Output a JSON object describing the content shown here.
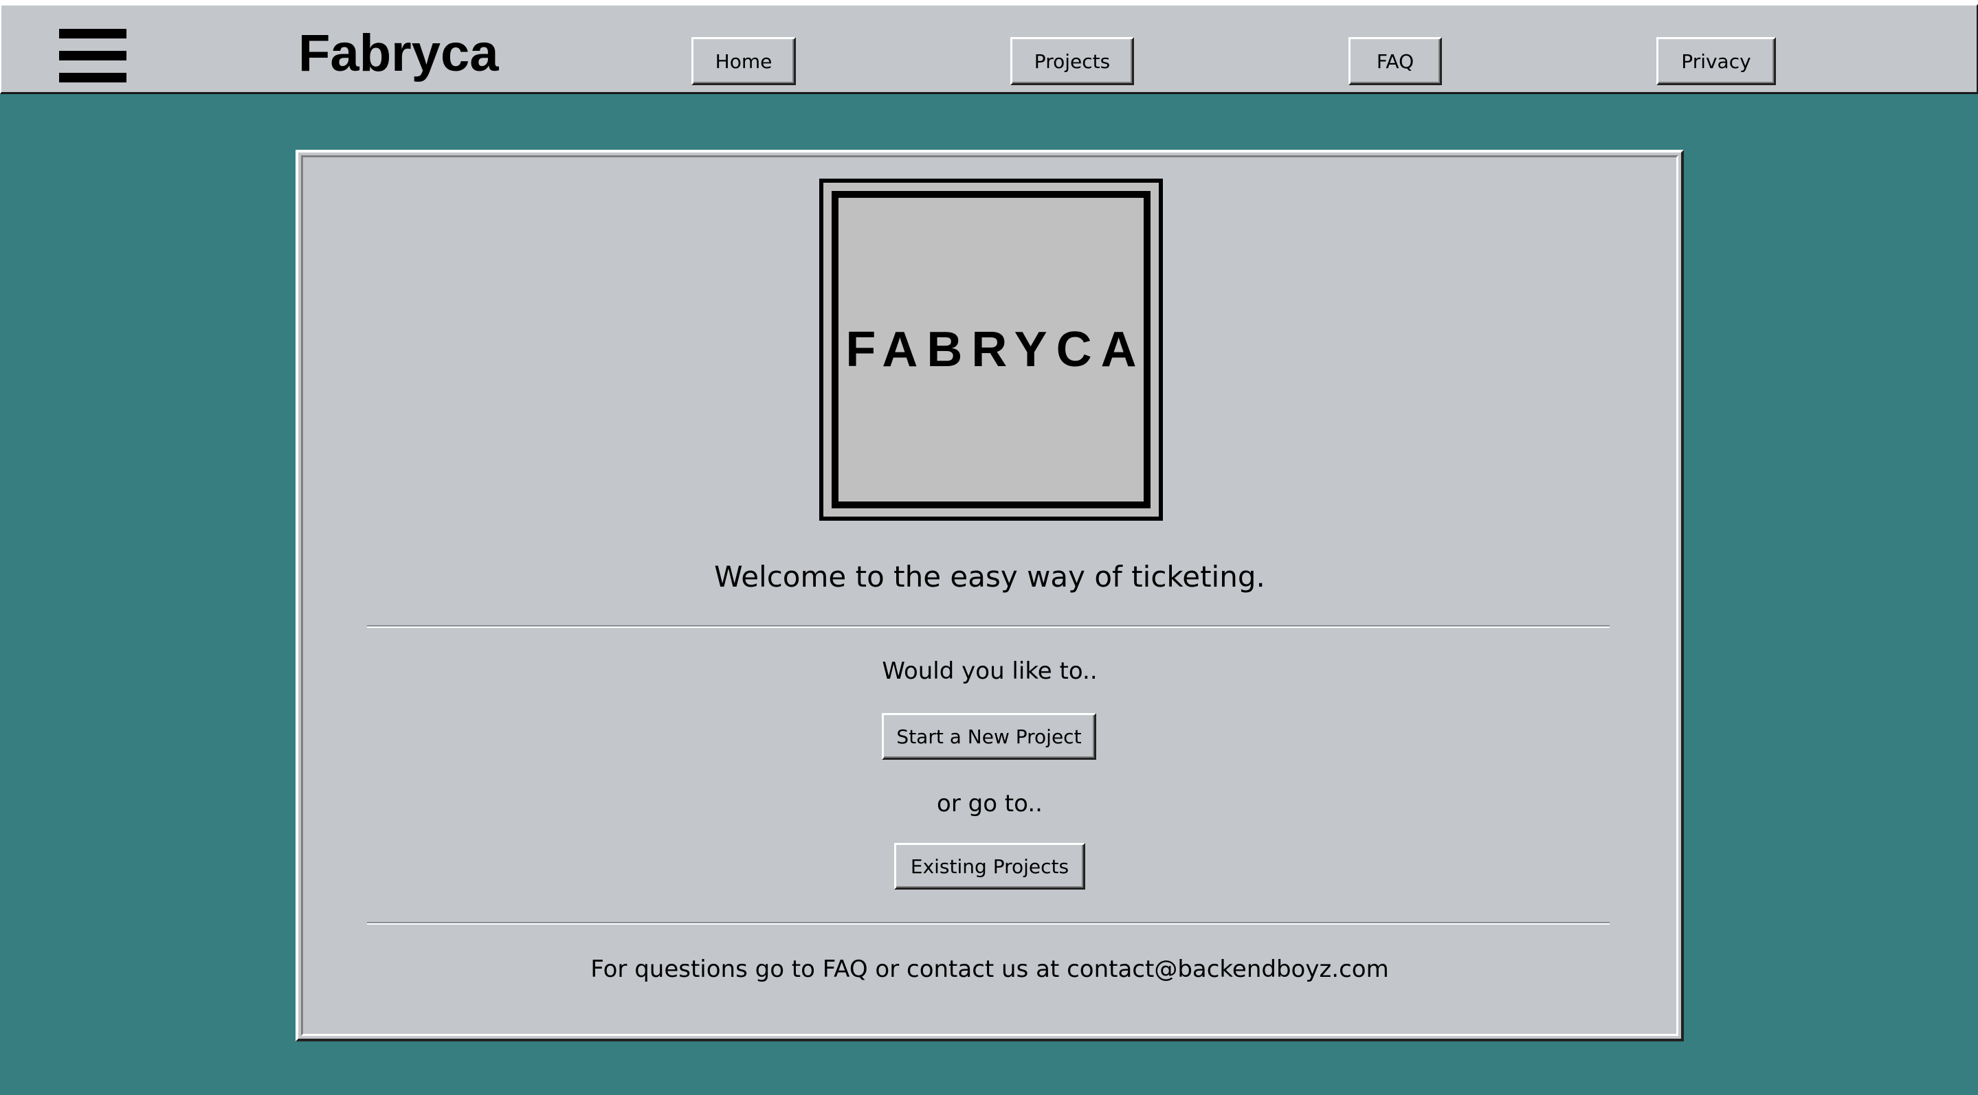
{
  "header": {
    "menu_icon": "hamburger-menu-icon",
    "brand": "Fabryca",
    "nav": {
      "home": "Home",
      "projects": "Projects",
      "faq": "FAQ",
      "privacy": "Privacy"
    }
  },
  "main": {
    "logo_text": "FABRYCA",
    "welcome": "Welcome to the easy way of ticketing.",
    "prompt": "Would you like to..",
    "start_button": "Start a New Project",
    "or_text": "or go to..",
    "existing_button": "Existing Projects",
    "footer": "For questions go to FAQ or contact us at contact@backendboyz.com"
  },
  "colors": {
    "background": "#367e80",
    "surface": "#c3c6cb",
    "text": "#000000"
  }
}
